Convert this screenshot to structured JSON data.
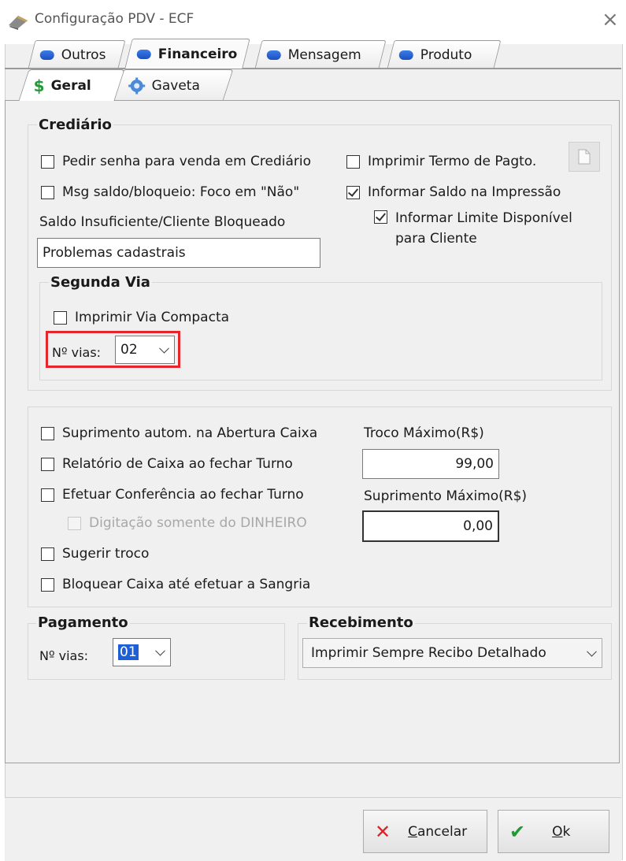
{
  "window": {
    "title": "Configuração PDV - ECF",
    "close_glyph": "×"
  },
  "tabs": [
    {
      "label": "Outros",
      "active": false
    },
    {
      "label": "Financeiro",
      "active": true
    },
    {
      "label": "Mensagem",
      "active": false
    },
    {
      "label": "Produto",
      "active": false
    }
  ],
  "subtabs": [
    {
      "label": "Geral",
      "icon": "dollar-icon",
      "active": true
    },
    {
      "label": "Gaveta",
      "icon": "gear-icon",
      "active": false
    }
  ],
  "crediario": {
    "title": "Crediário",
    "pedir_senha": {
      "label": "Pedir senha para venda em Crediário",
      "checked": false
    },
    "imprimir_termo": {
      "label": "Imprimir Termo de Pagto.",
      "checked": false
    },
    "msg_saldo": {
      "label": "Msg saldo/bloqueio: Foco em \"Não\"",
      "checked": false
    },
    "informar_saldo": {
      "label": "Informar Saldo na Impressão",
      "checked": true
    },
    "informar_limite": {
      "label_line1": "Informar Limite Disponível",
      "label_line2": "para Cliente",
      "checked": true
    },
    "saldo_label": "Saldo Insuficiente/Cliente Bloqueado",
    "saldo_value": "Problemas cadastrais",
    "segunda_via": {
      "title": "Segunda Via",
      "imprimir_compacta": {
        "label": "Imprimir Via Compacta",
        "checked": false
      },
      "vias_label": "Nº vias:",
      "vias_value": "02"
    }
  },
  "caixa": {
    "suprimento_autom": {
      "label": "Suprimento autom. na Abertura Caixa",
      "checked": false
    },
    "relatorio": {
      "label": "Relatório de Caixa ao fechar Turno",
      "checked": false
    },
    "conferencia": {
      "label": "Efetuar Conferência ao fechar Turno",
      "checked": false
    },
    "digitacao": {
      "label": "Digitação somente do DINHEIRO",
      "checked": false,
      "disabled": true
    },
    "sugerir_troco": {
      "label": "Sugerir troco",
      "checked": false
    },
    "bloquear": {
      "label": "Bloquear Caixa até efetuar a Sangria",
      "checked": false
    },
    "troco_label": "Troco Máximo(R$)",
    "troco_value": "99,00",
    "suprimento_label": "Suprimento Máximo(R$)",
    "suprimento_value": "0,00"
  },
  "pagamento": {
    "title": "Pagamento",
    "vias_label": "Nº vias:",
    "vias_value": "01"
  },
  "recebimento": {
    "title": "Recebimento",
    "value": "Imprimir Sempre Recibo Detalhado"
  },
  "buttons": {
    "cancel_label_first": "C",
    "cancel_label_rest": "ancelar",
    "ok_label_first": "O",
    "ok_label_rest": "k"
  },
  "colors": {
    "highlight": "#e8242c",
    "cancel_red": "#d9232a",
    "ok_green": "#1f9a35",
    "selection_blue": "#1e5fd6"
  }
}
